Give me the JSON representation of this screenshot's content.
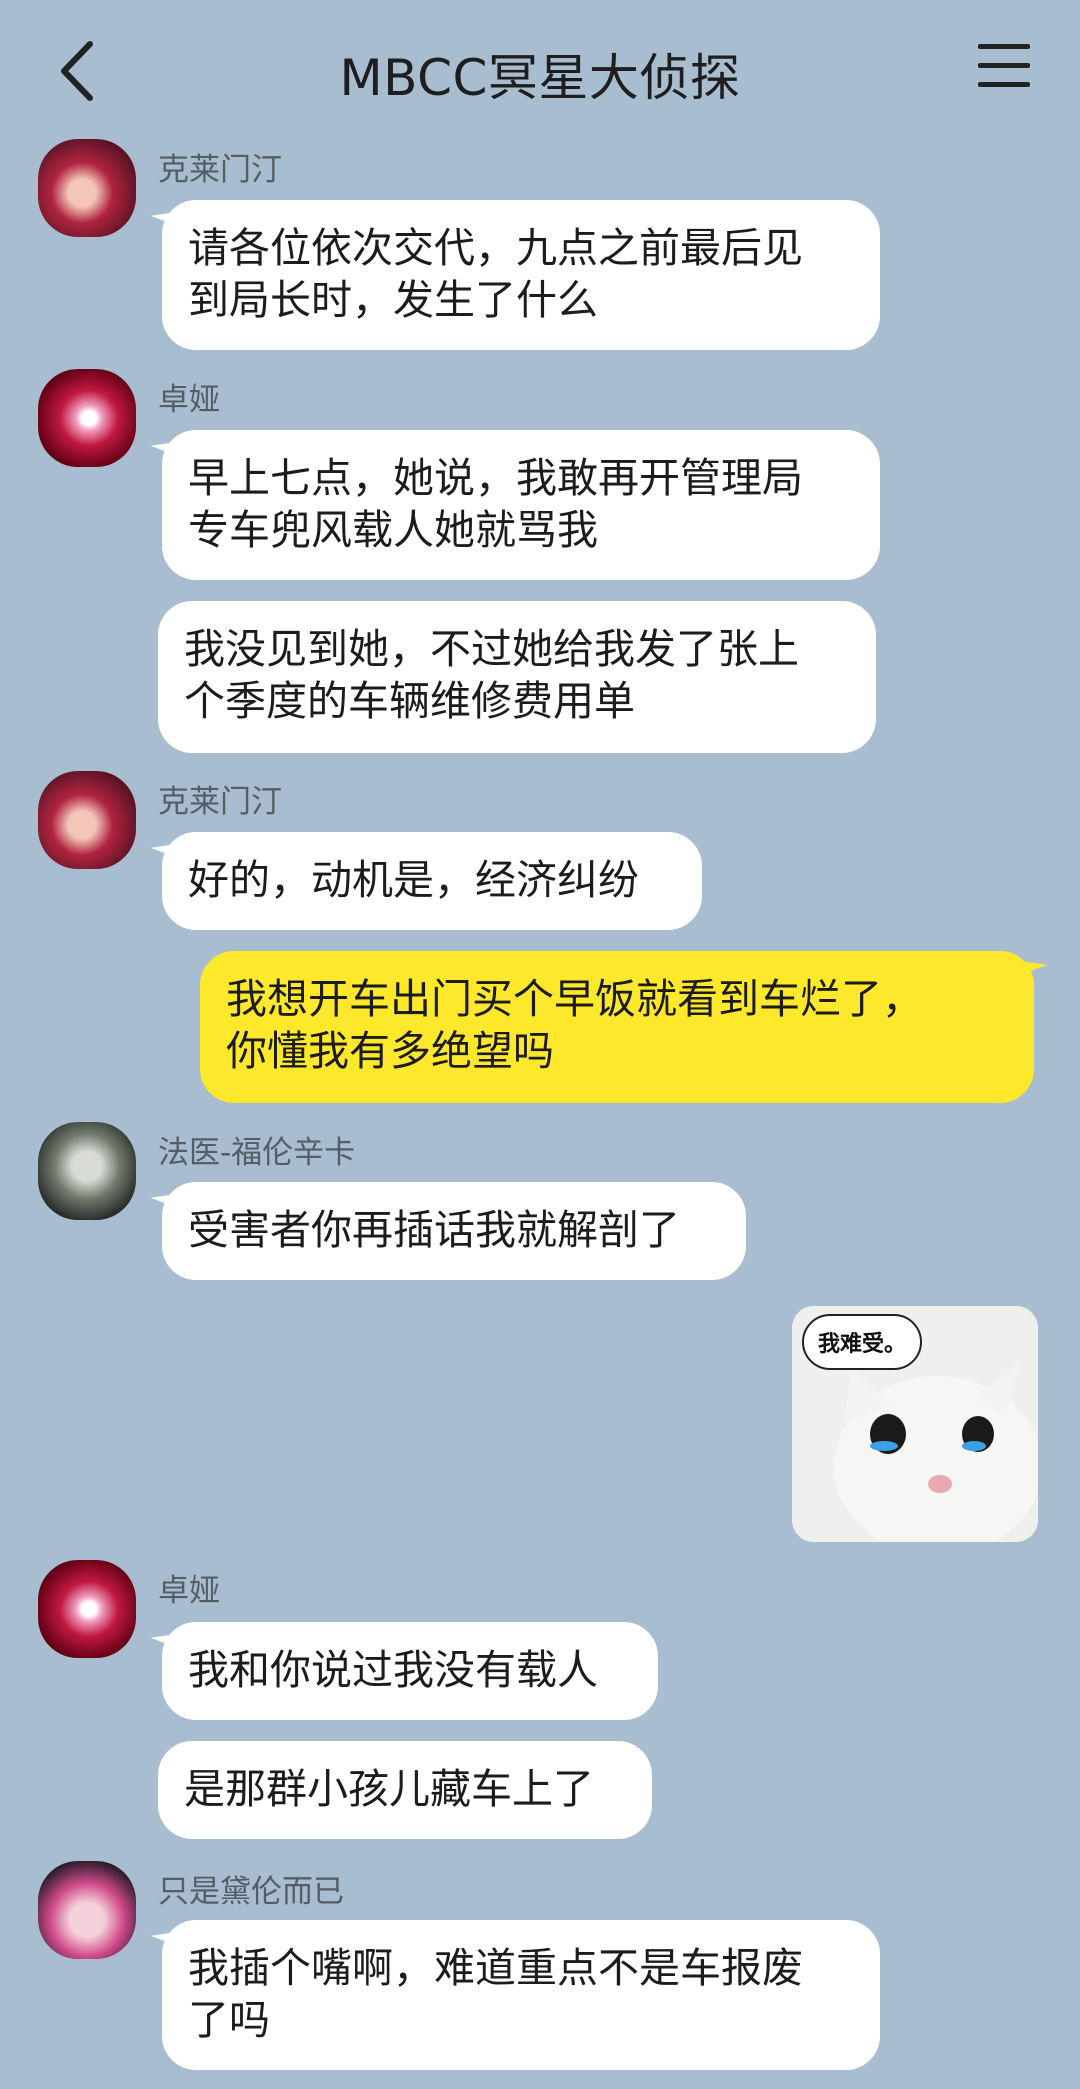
{
  "header": {
    "title": "MBCC冥星大侦探",
    "back_icon": "chevron-left-icon",
    "menu_icon": "hamburger-menu-icon"
  },
  "colors": {
    "background": "#a9bdd0",
    "bubble_other": "#ffffff",
    "bubble_mine": "#fde82c"
  },
  "messages": [
    {
      "sender": "克莱门汀",
      "text": "请各位依次交代，九点之前最后见\n到局长时，发生了什么"
    },
    {
      "sender": "卓娅",
      "text": "早上七点，她说，我敢再开管理局\n专车兜风载人她就骂我"
    },
    {
      "sender": "",
      "text": "我没见到她，不过她给我发了张上\n个季度的车辆维修费用单"
    },
    {
      "sender": "克莱门汀",
      "text": "好的，动机是，经济纠纷"
    },
    {
      "sender": "me",
      "text": "我想开车出门买个早饭就看到车烂了，\n你懂我有多绝望吗"
    },
    {
      "sender": "法医-福伦辛卡",
      "text": "受害者你再插话我就解剖了"
    },
    {
      "sender": "me",
      "sticker_text": "我难受。"
    },
    {
      "sender": "卓娅",
      "text": "我和你说过我没有载人"
    },
    {
      "sender": "",
      "text": "是那群小孩儿藏车上了"
    },
    {
      "sender": "只是黛伦而已",
      "text": "我插个嘴啊，难道重点不是车报废\n了吗"
    }
  ]
}
